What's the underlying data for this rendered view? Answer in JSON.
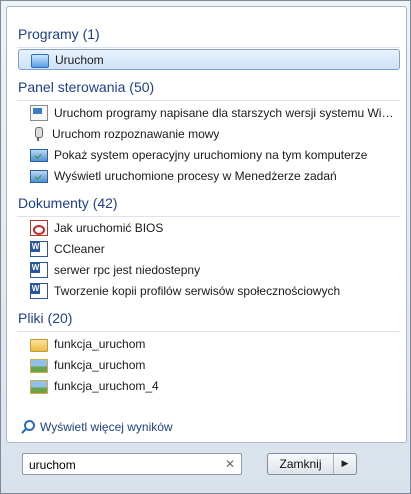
{
  "groups": [
    {
      "header": "Programy (1)",
      "items": [
        {
          "label": "Uruchom",
          "icon": "run-dialog-icon",
          "selected": true
        }
      ]
    },
    {
      "header": "Panel sterowania (50)",
      "items": [
        {
          "label": "Uruchom programy napisane dla starszych wersji systemu Win...",
          "icon": "program-compatibility-icon"
        },
        {
          "label": "Uruchom rozpoznawanie mowy",
          "icon": "microphone-icon"
        },
        {
          "label": "Pokaż system operacyjny uruchomiony na tym komputerze",
          "icon": "action-center-icon"
        },
        {
          "label": "Wyświetl uruchomione procesy w Menedżerze zadań",
          "icon": "action-center-icon"
        }
      ]
    },
    {
      "header": "Dokumenty (42)",
      "items": [
        {
          "label": "Jak uruchomić BIOS",
          "icon": "pdf-icon"
        },
        {
          "label": "CCleaner",
          "icon": "word-document-icon"
        },
        {
          "label": "serwer rpc jest niedostepny",
          "icon": "word-document-icon"
        },
        {
          "label": "Tworzenie kopii profilów serwisów społecznościowych",
          "icon": "word-document-icon"
        }
      ]
    },
    {
      "header": "Pliki (20)",
      "items": [
        {
          "label": "funkcja_uruchom",
          "icon": "folder-icon"
        },
        {
          "label": "funkcja_uruchom",
          "icon": "image-file-icon"
        },
        {
          "label": "funkcja_uruchom_4",
          "icon": "image-file-icon"
        }
      ]
    }
  ],
  "more_results": "Wyświetl więcej wyników",
  "search": {
    "value": "uruchom",
    "clear_glyph": "✕"
  },
  "shutdown": {
    "label": "Zamknij",
    "arrow_glyph": "▶"
  }
}
